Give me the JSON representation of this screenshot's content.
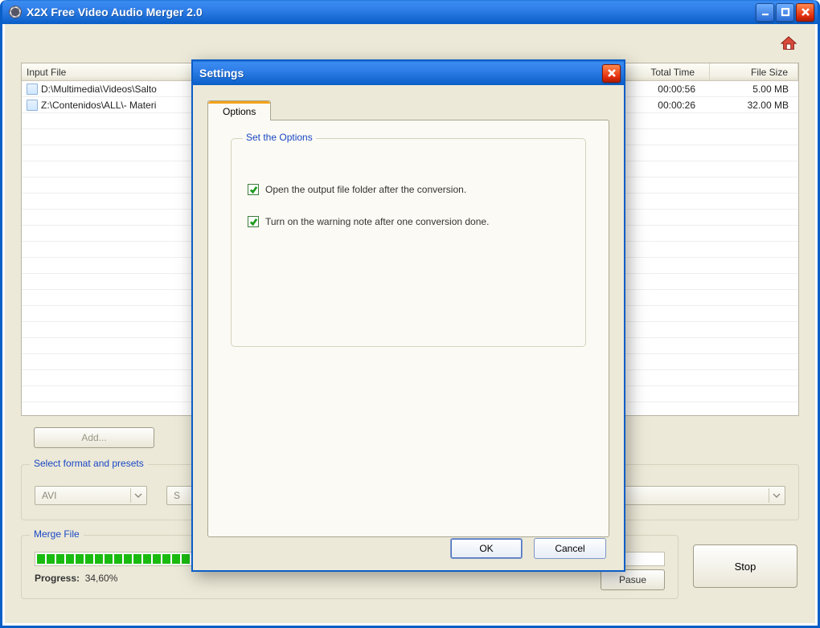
{
  "window": {
    "title": "X2X Free Video Audio Merger 2.0"
  },
  "table": {
    "headers": {
      "file": "Input File",
      "time": "Total Time",
      "size": "File Size"
    },
    "rows": [
      {
        "file": "D:\\Multimedia\\Videos\\Salto",
        "time": "00:00:56",
        "size": "5.00 MB"
      },
      {
        "file": "Z:\\Contenidos\\ALL\\- Materi",
        "time": "00:00:26",
        "size": "32.00 MB"
      }
    ]
  },
  "buttons": {
    "add": "Add...",
    "pause": "Pasue",
    "stop": "Stop"
  },
  "format_group": {
    "legend": "Select format and presets",
    "preset1": "AVI",
    "preset2_prefix": "S"
  },
  "merge_group": {
    "legend": "Merge File",
    "progress_word": "Progress:",
    "progress_value": "34,60%",
    "progress_cells_on": 18,
    "progress_cells_total": 52
  },
  "dialog": {
    "title": "Settings",
    "tab": "Options",
    "fieldset": "Set the Options",
    "opt1": "Open the output file folder after the conversion.",
    "opt2": "Turn on the warning note after one conversion done.",
    "ok": "OK",
    "cancel": "Cancel"
  }
}
